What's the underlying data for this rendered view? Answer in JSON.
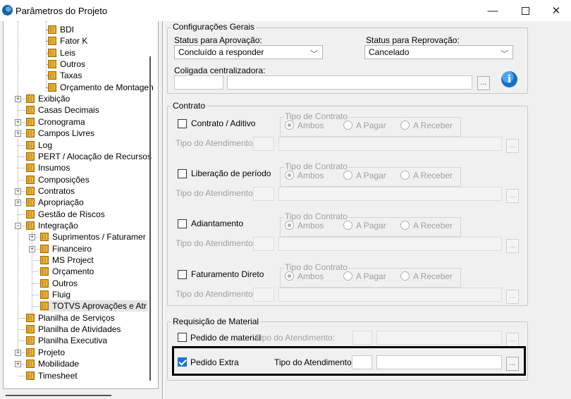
{
  "window": {
    "title": "Parâmetros do Projeto",
    "minimize": "—",
    "maximize": "□",
    "close": "✕"
  },
  "tree": {
    "items": [
      {
        "label": "BDI",
        "level": 3,
        "expandable": false
      },
      {
        "label": "Fator K",
        "level": 3,
        "expandable": false
      },
      {
        "label": "Leis",
        "level": 3,
        "expandable": false
      },
      {
        "label": "Outros",
        "level": 3,
        "expandable": false
      },
      {
        "label": "Taxas",
        "level": 3,
        "expandable": false
      },
      {
        "label": "Orçamento de Montagen",
        "level": 3,
        "expandable": false
      },
      {
        "label": "Exibição",
        "level": 1,
        "expandable": true
      },
      {
        "label": "Casas Decimais",
        "level": 1,
        "expandable": false
      },
      {
        "label": "Cronograma",
        "level": 1,
        "expandable": true
      },
      {
        "label": "Campos Livres",
        "level": 1,
        "expandable": true
      },
      {
        "label": "Log",
        "level": 1,
        "expandable": false
      },
      {
        "label": "PERT / Alocação de Recursos",
        "level": 1,
        "expandable": false
      },
      {
        "label": "Insumos",
        "level": 1,
        "expandable": false
      },
      {
        "label": "Composições",
        "level": 1,
        "expandable": false
      },
      {
        "label": "Contratos",
        "level": 1,
        "expandable": true
      },
      {
        "label": "Apropriação",
        "level": 1,
        "expandable": true
      },
      {
        "label": "Gestão de Riscos",
        "level": 1,
        "expandable": false
      },
      {
        "label": "Integração",
        "level": 1,
        "expandable": true,
        "expanded": true
      },
      {
        "label": "Suprimentos / Faturamer",
        "level": 2,
        "expandable": true
      },
      {
        "label": "Financeiro",
        "level": 2,
        "expandable": true
      },
      {
        "label": "MS Project",
        "level": 2,
        "expandable": false
      },
      {
        "label": "Orçamento",
        "level": 2,
        "expandable": false
      },
      {
        "label": "Outros",
        "level": 2,
        "expandable": false
      },
      {
        "label": "Fluig",
        "level": 2,
        "expandable": false
      },
      {
        "label": "TOTVS Aprovações e Atr",
        "level": 2,
        "expandable": false,
        "selected": true
      },
      {
        "label": "Planilha de Serviços",
        "level": 1,
        "expandable": false
      },
      {
        "label": "Planilha de Atividades",
        "level": 1,
        "expandable": false
      },
      {
        "label": "Planilha Executiva",
        "level": 1,
        "expandable": false
      },
      {
        "label": "Projeto",
        "level": 1,
        "expandable": true
      },
      {
        "label": "Mobilidade",
        "level": 1,
        "expandable": true
      },
      {
        "label": "Timesheet",
        "level": 1,
        "expandable": false
      }
    ]
  },
  "config_gerais": {
    "title": "Configurações Gerais",
    "status_aprovacao_label": "Status para Aprovação:",
    "status_aprovacao_value": "Concluído a responder",
    "status_reprovacao_label": "Status para Reprovação:",
    "status_reprovacao_value": "Cancelado",
    "coligada_label": "Coligada centralizadora:",
    "browse": "...",
    "info": "i"
  },
  "contrato": {
    "title": "Contrato",
    "tipo_contrato_label": "Tipo de Contrato",
    "tipo_contrato_label_alt": "Tipo do Contrato",
    "tipo_atendimento_label": "Tipo do Atendimento:",
    "options": [
      "Ambos",
      "A Pagar",
      "A Receber"
    ],
    "rows": [
      {
        "label": "Contrato / Aditivo",
        "group_label": "Tipo de Contrato"
      },
      {
        "label": "Liberação de período",
        "group_label": "Tipo de Contrato"
      },
      {
        "label": "Adiantamento",
        "group_label": "Tipo do Contrato"
      },
      {
        "label": "Faturamento Direto",
        "group_label": "Tipo do Contrato"
      }
    ]
  },
  "requisicao": {
    "title": "Requisição de Material",
    "pedido_material": "Pedido de material",
    "pedido_extra": "Pedido Extra",
    "tipo_atendimento_label": "Tipo do Atendimento:",
    "browse": "..."
  }
}
